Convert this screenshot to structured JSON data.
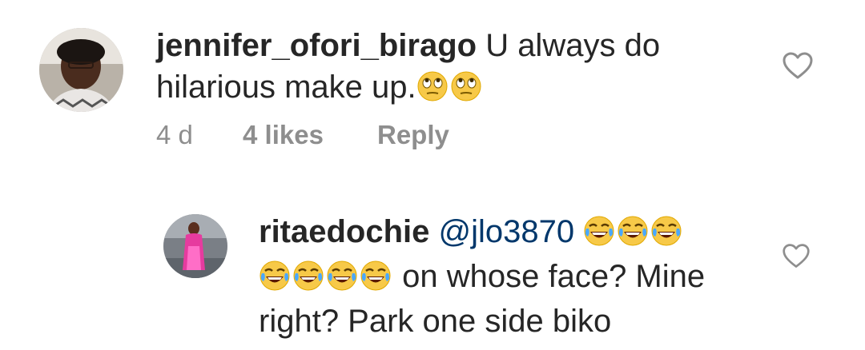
{
  "comments": [
    {
      "username": "jennifer_ofori_birago",
      "text_line1": "U always do",
      "text_line2": "hilarious make up.",
      "emojis_line2": [
        "face-with-rolling-eyes",
        "face-with-rolling-eyes"
      ],
      "age": "4 d",
      "likes": "4 likes",
      "reply_label": "Reply"
    },
    {
      "username": "ritaedochie",
      "mention": "@jlo3870",
      "emojis_line1": [
        "face-with-tears-of-joy",
        "face-with-tears-of-joy",
        "face-with-tears-of-joy"
      ],
      "emojis_line2": [
        "face-with-tears-of-joy",
        "face-with-tears-of-joy",
        "face-with-tears-of-joy",
        "face-with-tears-of-joy"
      ],
      "text_line2": "on whose face? Mine",
      "text_line3": "right? Park one side biko"
    }
  ],
  "colors": {
    "text": "#262626",
    "meta": "#8e8e8e",
    "mention": "#00376b",
    "emoji_face": "#f7c948"
  },
  "icons": {
    "like": "heart-outline-icon"
  }
}
